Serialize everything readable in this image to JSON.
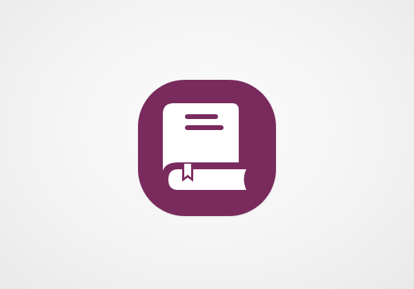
{
  "app_icon": {
    "icon": "book-icon",
    "colors": {
      "tile": "#7a2b5e",
      "glyph": "#ffffff",
      "background": "#f4f4f4"
    }
  }
}
